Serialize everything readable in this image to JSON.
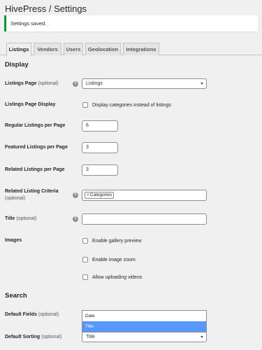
{
  "page": {
    "title": "HivePress / Settings"
  },
  "notice": {
    "text": "Settings saved.",
    "color": "#00a32a"
  },
  "tabs": [
    {
      "label": "Listings",
      "active": true
    },
    {
      "label": "Vendors"
    },
    {
      "label": "Users"
    },
    {
      "label": "Geolocation"
    },
    {
      "label": "Integrations"
    }
  ],
  "display": {
    "title": "Display",
    "listings_page": {
      "label": "Listings Page",
      "optional": "(optional)",
      "value": "Listings"
    },
    "listings_page_display": {
      "label": "Listings Page Display",
      "checkbox": "Display categories instead of listings"
    },
    "regular_per_page": {
      "label": "Regular Listings per Page",
      "value": "6"
    },
    "featured_per_page": {
      "label": "Featured Listings per Page",
      "value": "3"
    },
    "related_per_page": {
      "label": "Related Listings per Page",
      "value": "3"
    },
    "related_criteria": {
      "label": "Related Listing Criteria",
      "optional": "(optional)",
      "chip_remove": "×",
      "chip": "Categories"
    },
    "title_field": {
      "label": "Title",
      "optional": "(optional)",
      "value": ""
    },
    "images": {
      "label": "Images",
      "options": [
        "Enable gallery preview",
        "Enable image zoom",
        "Allow uploading videos"
      ]
    }
  },
  "search": {
    "title": "Search",
    "default_fields": {
      "label": "Default Fields",
      "optional": "(optional)",
      "options": [
        "Date",
        "Title"
      ],
      "highlighted": "Title"
    },
    "default_sorting": {
      "label": "Default Sorting",
      "optional": "(optional)",
      "value": "Title"
    }
  },
  "icons": {
    "help": "help-icon",
    "caret": "chevron-down-icon"
  },
  "colors": {
    "highlight": "#5897fb",
    "background": "#f0f0f1"
  }
}
